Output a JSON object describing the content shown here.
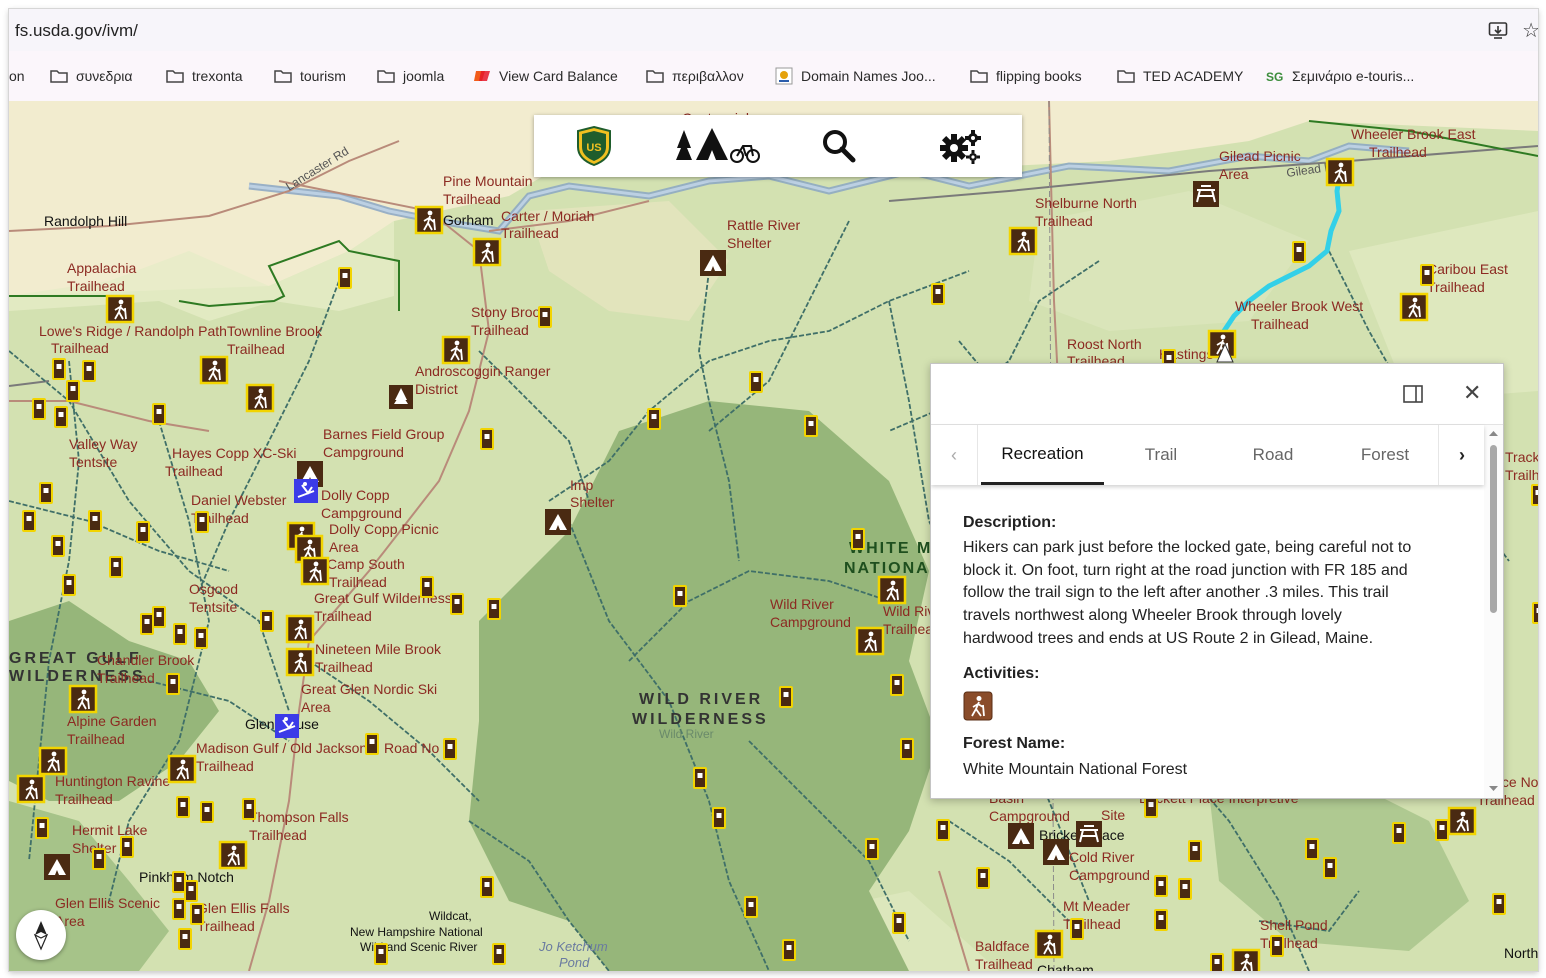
{
  "browser": {
    "url": "fs.usda.gov/ivm/",
    "bookmarks": [
      {
        "label": "on",
        "type": "text"
      },
      {
        "label": "συνεδρια",
        "type": "folder"
      },
      {
        "label": "trexonta",
        "type": "folder"
      },
      {
        "label": "tourism",
        "type": "folder"
      },
      {
        "label": "joomla",
        "type": "folder"
      },
      {
        "label": "View Card Balance",
        "type": "site"
      },
      {
        "label": "περιβαλλον",
        "type": "folder"
      },
      {
        "label": "Domain Names Joo...",
        "type": "site"
      },
      {
        "label": "flipping books",
        "type": "folder"
      },
      {
        "label": "TED ACADEMY",
        "type": "folder"
      },
      {
        "label": "Σεμινάριο e-touris...",
        "type": "site"
      }
    ]
  },
  "toolbar": {
    "items": [
      {
        "name": "usfs-shield-icon"
      },
      {
        "name": "recreation-activities-icon"
      },
      {
        "name": "search-icon"
      },
      {
        "name": "settings-icon"
      }
    ],
    "shield_text": "US"
  },
  "map": {
    "colors": {
      "base": "#f2eccf",
      "forest": "#d3e1b1",
      "wilderness": "#96b67a",
      "trail": "#3f6f68",
      "highlight": "#33d0e8",
      "label": "#8c2a22",
      "marker_border": "#f2d400"
    },
    "labels": {
      "randolph_hill": "Randolph Hill",
      "centennial": "Centennial",
      "lancaster_rd": "Lancaster Rd",
      "pine_mountain": [
        "Pine Mountain",
        "Trailhead"
      ],
      "gorham": "Gorham",
      "carter_moriah": [
        "Carter / Moriah",
        "Trailhead"
      ],
      "rattle_river": [
        "Rattle River",
        "Shelter"
      ],
      "appalachia": [
        "Appalachia",
        "Trailhead"
      ],
      "stony_brook": [
        "Stony Brook",
        "Trailhead"
      ],
      "lowes_ridge": [
        "Lowe's Ridge / Randolph Path",
        "Trailhead"
      ],
      "townline_brook": [
        "Townline Brook",
        "Trailhead"
      ],
      "androscoggin": [
        "Androscoggin Ranger",
        "District"
      ],
      "valley_way": [
        "Valley Way",
        "Tentsite"
      ],
      "hayes_copp": [
        "Hayes Copp XC-Ski",
        "Trailhead"
      ],
      "barnes_field": [
        "Barnes Field Group",
        "Campground"
      ],
      "daniel_webster": [
        "Daniel Webster",
        "Trailhead"
      ],
      "dolly_copp_cg": [
        "Dolly Copp",
        "Campground"
      ],
      "dolly_copp_picnic": [
        "Dolly Copp Picnic",
        "Area"
      ],
      "camp_south": [
        "Camp South",
        "Trailhead"
      ],
      "imp_shelter": [
        "Imp",
        "Shelter"
      ],
      "osgood": [
        "Osgood",
        "Tentsite"
      ],
      "great_gulf_th": [
        "Great Gulf Wilderness",
        "Trailhead"
      ],
      "great_gulf_wild": [
        "GREAT GULF",
        "WILDERNESS"
      ],
      "chandler_brook": [
        "Chandler Brook",
        "Trailhead"
      ],
      "nineteen_mile": [
        "Nineteen Mile Brook",
        "Trailhead"
      ],
      "alpine_garden": [
        "Alpine Garden",
        "Trailhead"
      ],
      "great_glen": [
        "Great Glen Nordic Ski",
        "Area"
      ],
      "glen_house": "Glen House",
      "madison_gulf": [
        "Madison Gulf / Old Jackson",
        "Trailhead"
      ],
      "road_no": "Road No",
      "huntington": [
        "Huntington Ravine",
        "Trailhead"
      ],
      "hermit_lake": [
        "Hermit Lake",
        "Shelter"
      ],
      "thompson_falls": [
        "Thompson Falls",
        "Trailhead"
      ],
      "pinkham_notch": "Pinkham Notch",
      "glen_ellis": [
        "Glen Ellis Scenic",
        "Area"
      ],
      "glen_ellis_th": [
        "Glen Ellis Falls",
        "Trailhead"
      ],
      "wildcat": [
        "Wildcat,",
        "New Hampshire National",
        "Wild and Scenic River"
      ],
      "ketchum": [
        "Jo Ketchum",
        "Pond"
      ],
      "wild_river_wild": [
        "WILD RIVER",
        "WILDERNESS"
      ],
      "wild_river_small": "Wild River",
      "wild_river_cg": [
        "Wild River",
        "Campground"
      ],
      "wild_river_th": [
        "Wild River",
        "Trailhead"
      ],
      "white_mtn_nf": [
        "WHITE MOUNTAIN",
        "NATIONAL"
      ],
      "gilead_picnic": [
        "Gilead Picnic",
        "Area"
      ],
      "wheeler_east": [
        "Wheeler Brook East",
        "Trailhead"
      ],
      "shelburne_north": [
        "Shelburne North",
        "Trailhead"
      ],
      "caribou_east": [
        "Caribou East",
        "Trailhead"
      ],
      "wheeler_west": [
        "Wheeler Brook West",
        "Trailhead"
      ],
      "roost_north": [
        "Roost North",
        "Trailhead"
      ],
      "hastings": "Hastings",
      "track_north": [
        "Track North",
        "Trailhead"
      ],
      "basin": [
        "Basin",
        "Campground"
      ],
      "brickett": "Brickett Place",
      "brickett_site": [
        "Site"
      ],
      "interpretive": "Brickett Place Interpretive",
      "cold_river": [
        "Cold River",
        "Campground"
      ],
      "mt_meader": [
        "Mt Meader",
        "Trailhead"
      ],
      "shell_pond": [
        "Shell Pond",
        "Trailhead"
      ],
      "baldface": [
        "Baldface",
        "Trailhead"
      ],
      "chatham": "Chatham",
      "north_label": "North",
      "royce": [
        "Royce Notch",
        "Trailhead"
      ],
      "gilead_road": "Gilead Road"
    }
  },
  "popup": {
    "tabs": [
      "Recreation",
      "Trail",
      "Road",
      "Forest"
    ],
    "active_tab": "Recreation",
    "description_label": "Description:",
    "description_lines": [
      "Hikers can park just before the locked gate, being careful not to",
      "block it. On foot, turn right at the road junction with FR 185 and",
      "follow the trail sign to the left after another .3 miles. This trail",
      "travels northwest along Wheeler Brook through lovely",
      "hardwood trees and ends at US Route 2 in Gilead, Maine."
    ],
    "activities_label": "Activities:",
    "activities": [
      {
        "icon": "hiking-activity-icon"
      }
    ],
    "forest_label": "Forest Name:",
    "forest_value": "White Mountain National Forest"
  }
}
